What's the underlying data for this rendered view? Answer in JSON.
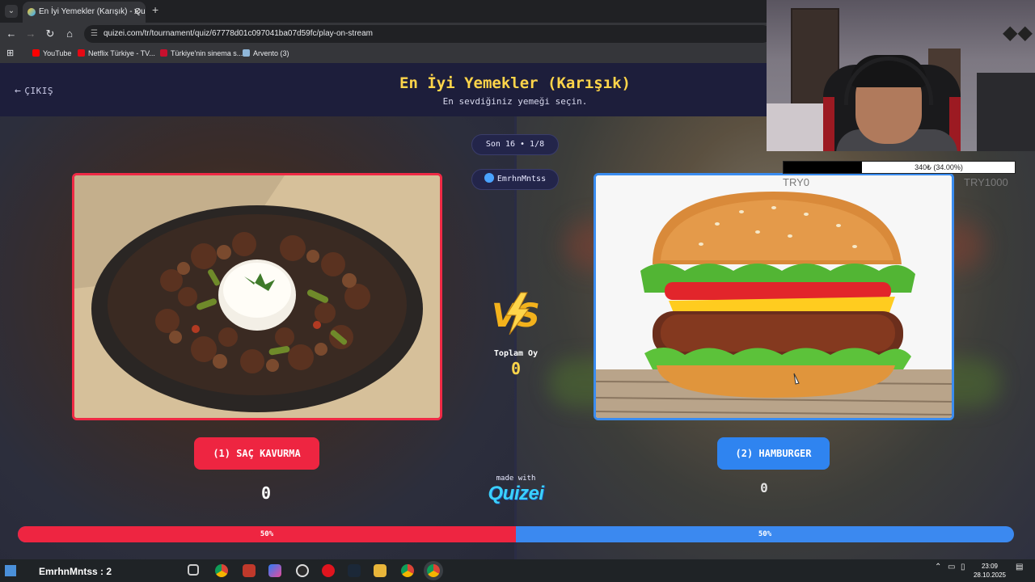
{
  "browser": {
    "tab_title": "En İyi Yemekler (Karışık) - Quizei",
    "url": "quizei.com/tr/tournament/quiz/67778d01c097041ba07d59fc/play-on-stream",
    "bookmarks": [
      {
        "label": "YouTube",
        "color": "#ff0000"
      },
      {
        "label": "Netflix Türkiye - TV...",
        "color": "#e50914"
      },
      {
        "label": "Türkiye'nin sinema s...",
        "color": "#c8102e"
      },
      {
        "label": "Arvento (3)",
        "color": "#8fb6d9"
      }
    ]
  },
  "header": {
    "exit_label": "ÇIKIŞ",
    "title": "En İyi Yemekler (Karışık)",
    "subtitle": "En sevdiğiniz yemeği seçin."
  },
  "round": {
    "label": "Son 16 • 1/8",
    "streamer": "EmrhnMntss"
  },
  "left_choice": {
    "label": "(1) SAÇ KAVURMA",
    "votes": "0",
    "accent": "#ee2541"
  },
  "right_choice": {
    "label": "(2) HAMBURGER",
    "votes": "0",
    "accent": "#2f84f0"
  },
  "center": {
    "vs_text": "VS",
    "total_label": "Toplam Oy",
    "total_votes": "0",
    "made_with": "made with",
    "brand": "Quizei"
  },
  "progress": {
    "left_fraction": 0.5,
    "left_label": "50%",
    "right_label": "50%"
  },
  "stream_overlay": {
    "donation_text": "340₺ (34.00%)",
    "donation_fraction": 0.34,
    "goal_start": "TRY0",
    "goal_end": "TRY1000"
  },
  "taskbar": {
    "chat_line": "EmrhnMntss : 2",
    "time": "23:09",
    "date": "28.10.2025"
  }
}
